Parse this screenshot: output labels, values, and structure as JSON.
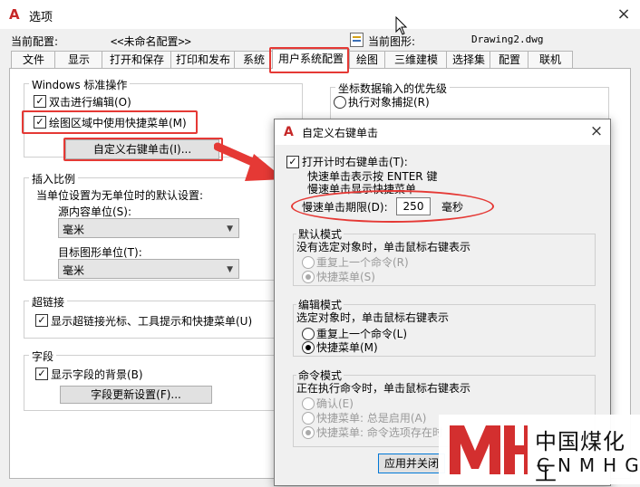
{
  "window": {
    "title": "选项",
    "close_glyph": "×",
    "logo_letter": "A"
  },
  "profile": {
    "label": "当前配置:",
    "value": "<<未命名配置>>"
  },
  "drawing": {
    "label": "当前图形:",
    "value": "Drawing2.dwg"
  },
  "tabs": [
    "文件",
    "显示",
    "打开和保存",
    "打印和发布",
    "系统",
    "用户系统配置",
    "绘图",
    "三维建模",
    "选择集",
    "配置",
    "联机"
  ],
  "active_tab": "用户系统配置",
  "windows_ops": {
    "legend": "Windows 标准操作",
    "dblclick_edit": {
      "label": "双击进行编辑(O)",
      "checked": true
    },
    "shortcut_menu": {
      "label": "绘图区域中使用快捷菜单(M)",
      "checked": true
    },
    "customize_button": "自定义右键单击(I)..."
  },
  "insert_scale": {
    "legend": "插入比例",
    "desc": "当单位设置为无单位时的默认设置:",
    "source_label": "源内容单位(S):",
    "source_value": "毫米",
    "target_label": "目标图形单位(T):",
    "target_value": "毫米"
  },
  "hyperlink": {
    "legend": "超链接",
    "show": {
      "label": "显示超链接光标、工具提示和快捷菜单(U)",
      "checked": true
    }
  },
  "fields": {
    "legend": "字段",
    "show_bg": {
      "label": "显示字段的背景(B)",
      "checked": true
    },
    "update_button": "字段更新设置(F)..."
  },
  "coord_priority": {
    "legend": "坐标数据输入的优先级",
    "opt1": "执行对象捕捉(R)"
  },
  "dialog": {
    "title": "自定义右键单击",
    "close_glyph": "×",
    "timed_rc": {
      "label": "打开计时右键单击(T):",
      "checked": true
    },
    "quick_line1": "快速单击表示按 ENTER 键",
    "quick_line2": "慢速单击显示快捷菜单",
    "slow_label": "慢速单击期限(D):",
    "slow_value": "250",
    "slow_unit": "毫秒",
    "default_mode": {
      "legend": "默认模式",
      "desc": "没有选定对象时，单击鼠标右键表示",
      "opt_repeat": "重复上一个命令(R)",
      "opt_menu": "快捷菜单(S)"
    },
    "edit_mode": {
      "legend": "编辑模式",
      "desc": "选定对象时，单击鼠标右键表示",
      "opt_repeat": "重复上一个命令(L)",
      "opt_menu": "快捷菜单(M)"
    },
    "command_mode": {
      "legend": "命令模式",
      "desc": "正在执行命令时，单击鼠标右键表示",
      "opt_confirm": "确认(E)",
      "opt_always": "快捷菜单: 总是启用(A)",
      "opt_when": "快捷菜单: 命令选项存在时"
    },
    "apply_close": "应用并关闭"
  },
  "watermark": {
    "cn": "中国煤化工",
    "en": "CNMHG",
    "logo": "MH"
  },
  "colors": {
    "accent_red": "#e53935",
    "watermark_red": "#d32f2f",
    "logo_red": "#c62828"
  }
}
